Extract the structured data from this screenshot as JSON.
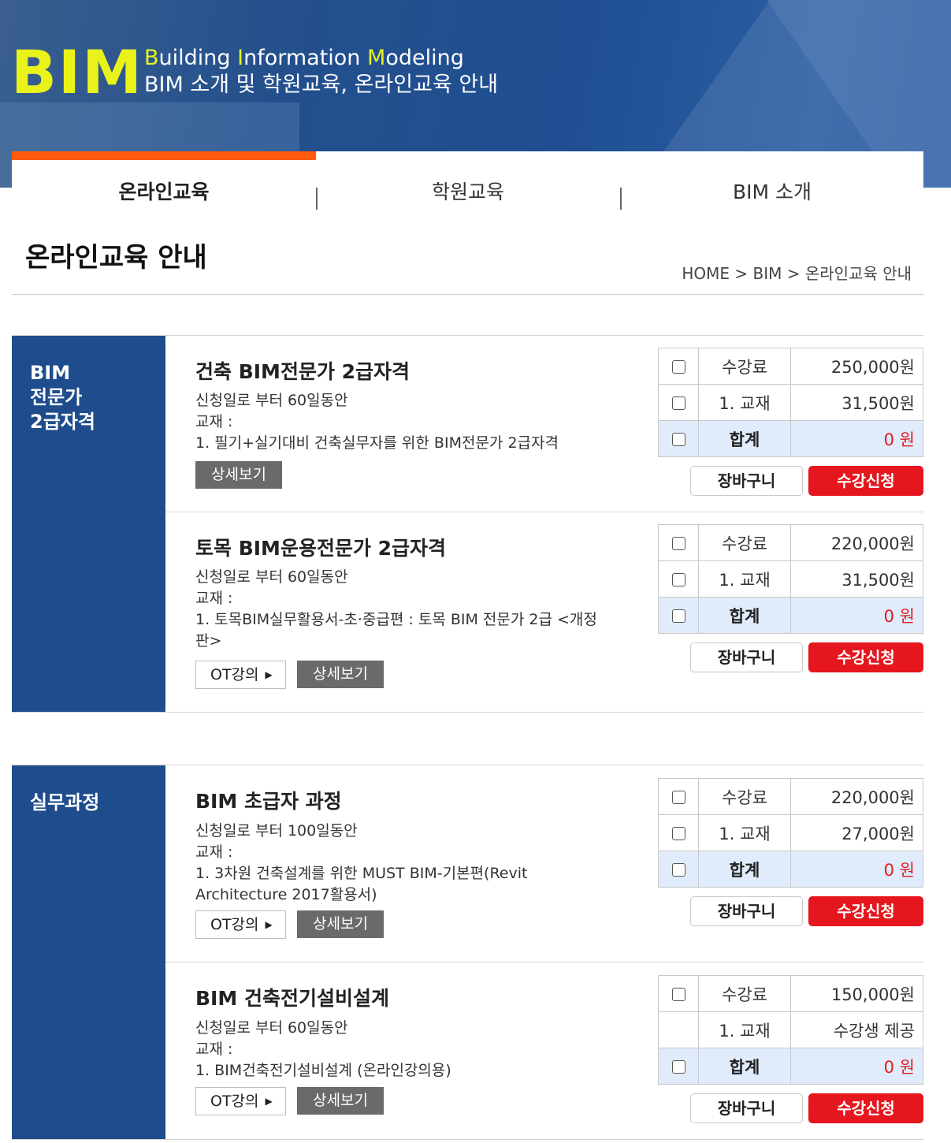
{
  "header": {
    "logo": "BIM",
    "subtitle_parts": [
      "B",
      "uilding ",
      "I",
      "nformation ",
      "M",
      "odeling"
    ],
    "tagline": "BIM 소개 및 학원교육, 온라인교육 안내"
  },
  "nav": {
    "tabs": [
      {
        "label": "온라인교육",
        "active": true
      },
      {
        "label": "학원교육",
        "active": false
      },
      {
        "label": "BIM 소개",
        "active": false
      }
    ]
  },
  "page": {
    "title": "온라인교육 안내",
    "breadcrumb": "HOME > BIM > 온라인교육 안내"
  },
  "sections": [
    {
      "category": [
        "BIM",
        "전문가",
        "2급자격"
      ],
      "courses": [
        {
          "name": "건축 BIM전문가 2급자격",
          "period": "신청일로 부터 60일동안",
          "textbook_label": "교재 :",
          "textbook": "1. 필기+실기대비 건축실무자를 위한 BIM전문가 2급자격",
          "detail_label": "상세보기",
          "prices": [
            {
              "label": "수강료",
              "value": "250,000원"
            },
            {
              "label": "1. 교재",
              "value": "31,500원"
            },
            {
              "label": "합계",
              "value": "0 원"
            }
          ],
          "cart_label": "장바구니",
          "apply_label": "수강신청"
        },
        {
          "name": "토목 BIM운용전문가 2급자격",
          "period": "신청일로 부터 60일동안",
          "textbook_label": "교재 :",
          "textbook": "1. 토목BIM실무활용서-초·중급편 : 토목 BIM 전문가 2급 <개정판>",
          "ot_label": "OT강의",
          "detail_label": "상세보기",
          "prices": [
            {
              "label": "수강료",
              "value": "220,000원"
            },
            {
              "label": "1. 교재",
              "value": "31,500원"
            },
            {
              "label": "합계",
              "value": "0 원"
            }
          ],
          "cart_label": "장바구니",
          "apply_label": "수강신청"
        }
      ]
    },
    {
      "category": [
        "실무과정"
      ],
      "courses": [
        {
          "name": "BIM 초급자 과정",
          "period": "신청일로 부터 100일동안",
          "textbook_label": "교재 :",
          "textbook": "1. 3차원 건축설계를 위한 MUST BIM-기본편(Revit Architecture 2017활용서)",
          "ot_label": "OT강의",
          "detail_label": "상세보기",
          "prices": [
            {
              "label": "수강료",
              "value": "220,000원"
            },
            {
              "label": "1. 교재",
              "value": "27,000원"
            },
            {
              "label": "합계",
              "value": "0 원"
            }
          ],
          "cart_label": "장바구니",
          "apply_label": "수강신청"
        },
        {
          "name": "BIM 건축전기설비설계",
          "period": "신청일로 부터 60일동안",
          "textbook_label": "교재 :",
          "textbook": "1. BIM건축전기설비설계 (온라인강의용)",
          "ot_label": "OT강의",
          "detail_label": "상세보기",
          "prices": [
            {
              "label": "수강료",
              "value": "150,000원"
            },
            {
              "label": "1. 교재",
              "value": "수강생 제공"
            },
            {
              "label": "합계",
              "value": "0 원"
            }
          ],
          "cart_label": "장바구니",
          "apply_label": "수강신청"
        }
      ]
    }
  ],
  "colors": {
    "banner": "#1f4f92",
    "logo_yellow": "#e9f31a",
    "nav_active": "#ff5a10",
    "category_bg": "#1e4c8c",
    "apply_red": "#e5161d",
    "total_bg": "#e0ecfb"
  }
}
